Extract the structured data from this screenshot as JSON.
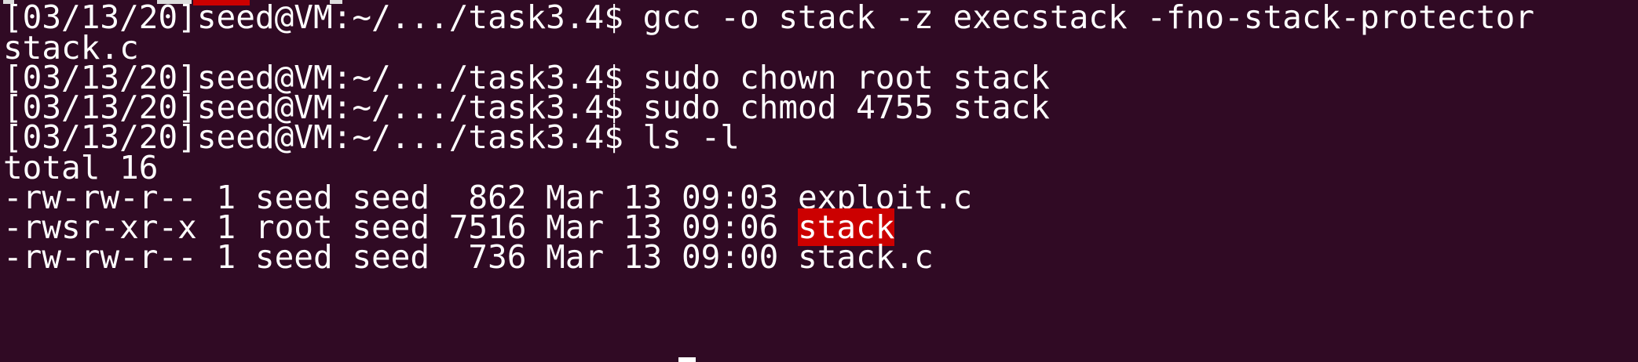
{
  "terminal": {
    "colors": {
      "background": "#300a24",
      "foreground": "#ffffff",
      "highlight": "#cc0000"
    },
    "lines": [
      {
        "before": "[03/13/20]seed@VM:~/.../task3.4$ gcc -o stack -z execstack -fno-stack-protector",
        "hl": "",
        "after": ""
      },
      {
        "before": "stack.c",
        "hl": "",
        "after": ""
      },
      {
        "before": "[03/13/20]seed@VM:~/.../task3.4$ sudo chown root stack",
        "hl": "",
        "after": ""
      },
      {
        "before": "[03/13/20]seed@VM:~/.../task3.4$ sudo chmod 4755 stack",
        "hl": "",
        "after": ""
      },
      {
        "before": "[03/13/20]seed@VM:~/.../task3.4$ ls -l",
        "hl": "",
        "after": ""
      },
      {
        "before": "total 16",
        "hl": "",
        "after": ""
      },
      {
        "before": "-rw-rw-r-- 1 seed seed  862 Mar 13 09:03 exploit.c",
        "hl": "",
        "after": ""
      },
      {
        "before": "-rwsr-xr-x 1 root seed 7516 Mar 13 09:06 ",
        "hl": "stack",
        "after": ""
      },
      {
        "before": "-rw-rw-r-- 1 seed seed  736 Mar 13 09:00 stack.c",
        "hl": "",
        "after": ""
      }
    ]
  }
}
